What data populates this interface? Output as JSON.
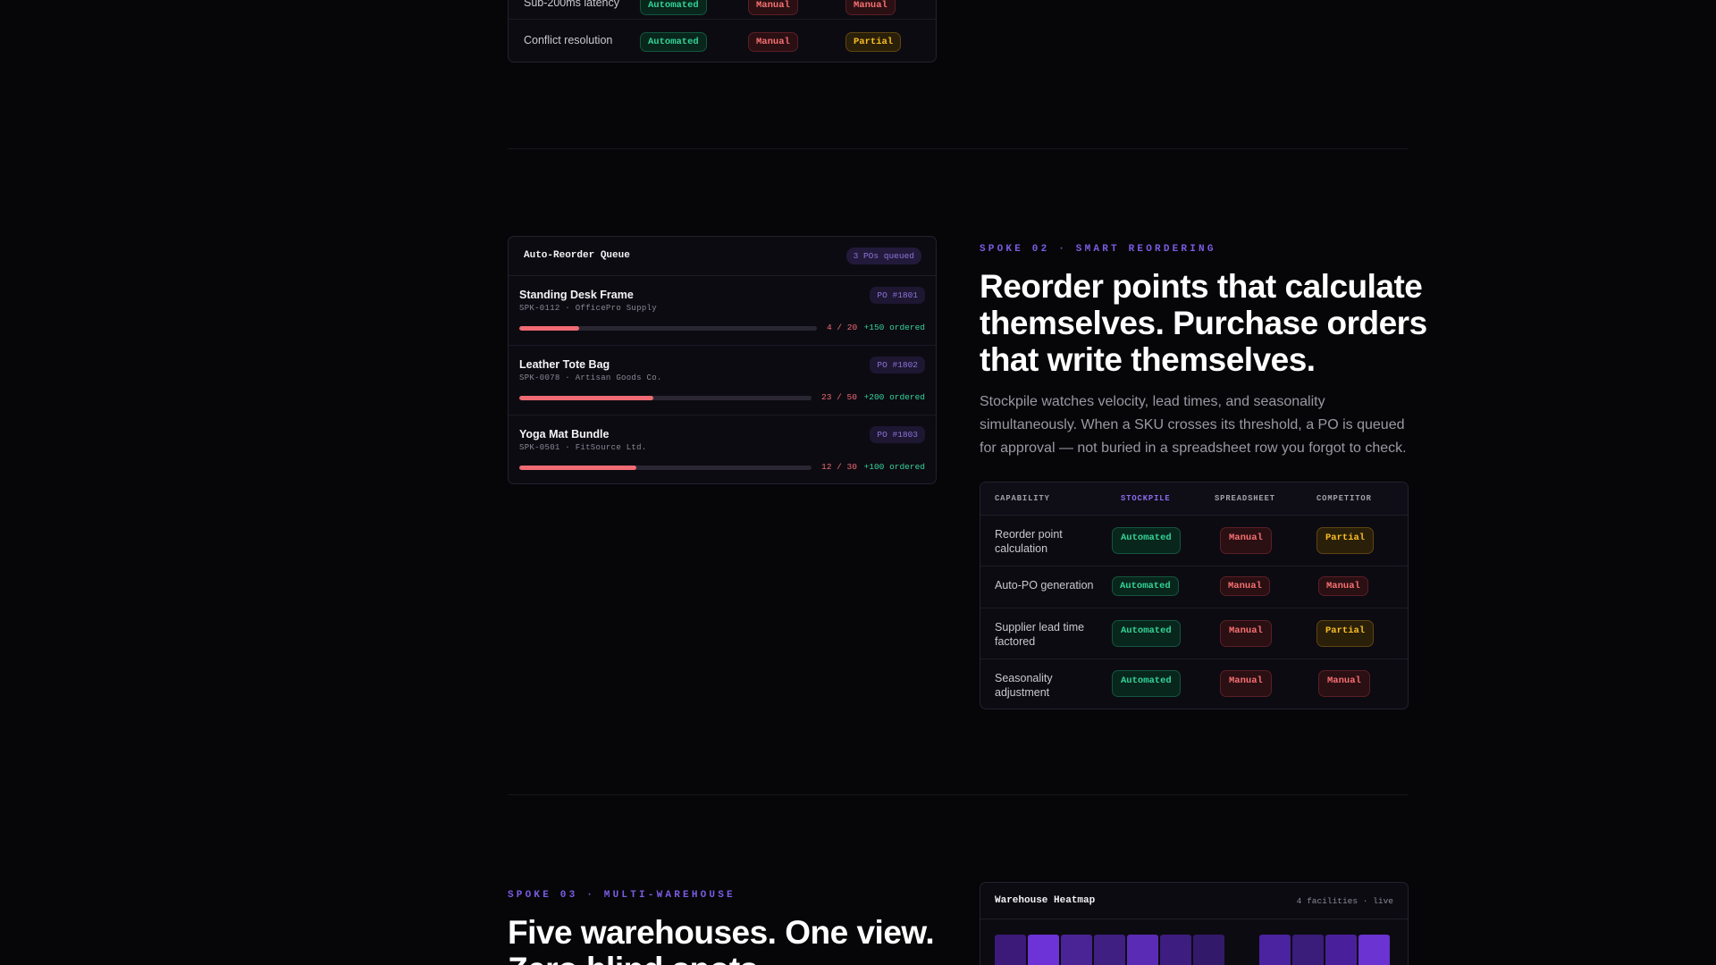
{
  "top_table": {
    "rows": [
      {
        "label": "Sub-200ms latency",
        "stockpile": "Automated",
        "spreadsheet": "Manual",
        "competitor": "Manual"
      },
      {
        "label": "Conflict resolution",
        "stockpile": "Automated",
        "spreadsheet": "Manual",
        "competitor": "Partial"
      }
    ]
  },
  "queue": {
    "title": "Auto-Reorder Queue",
    "count": "3 POs queued",
    "items": [
      {
        "name": "Standing Desk Frame",
        "sku": "SPK-0112 · OfficePro Supply",
        "po": "PO #1801",
        "stock": "4 / 20",
        "ordered": "+150 ordered",
        "level": 0.2
      },
      {
        "name": "Leather Tote Bag",
        "sku": "SPK-0078 · Artisan Goods Co.",
        "po": "PO #1802",
        "stock": "23 / 50",
        "ordered": "+200 ordered",
        "level": 0.46
      },
      {
        "name": "Yoga Mat Bundle",
        "sku": "SPK-0501 · FitSource Ltd.",
        "po": "PO #1803",
        "stock": "12 / 30",
        "ordered": "+100 ordered",
        "level": 0.4
      }
    ]
  },
  "spoke2": {
    "eyebrow": "SPOKE 02 · SMART REORDERING",
    "headline_1": "Reorder points that calculate",
    "headline_2": "themselves. Purchase orders",
    "headline_3": "that write themselves.",
    "body_1": "Stockpile watches velocity, lead times, and seasonality",
    "body_2": "simultaneously. When a SKU crosses its threshold, a PO is queued",
    "body_3": "for approval — not buried in a spreadsheet row you forgot to check."
  },
  "capability_table": {
    "headers": {
      "capability": "CAPABILITY",
      "stockpile": "STOCKPILE",
      "spreadsheet": "SPREADSHEET",
      "competitor": "COMPETITOR"
    },
    "rows": [
      {
        "label_1": "Reorder point",
        "label_2": "calculation",
        "stockpile": "Automated",
        "spreadsheet": "Manual",
        "competitor": "Partial"
      },
      {
        "label_1": "Auto-PO generation",
        "label_2": "",
        "stockpile": "Automated",
        "spreadsheet": "Manual",
        "competitor": "Manual"
      },
      {
        "label_1": "Supplier lead time",
        "label_2": "factored",
        "stockpile": "Automated",
        "spreadsheet": "Manual",
        "competitor": "Partial"
      },
      {
        "label_1": "Seasonality",
        "label_2": "adjustment",
        "stockpile": "Automated",
        "spreadsheet": "Manual",
        "competitor": "Manual"
      }
    ]
  },
  "spoke3": {
    "eyebrow": "SPOKE 03 · MULTI-WAREHOUSE",
    "headline_1": "Five warehouses. One view.",
    "headline_2": "Zero blind spots."
  },
  "heatmap": {
    "title": "Warehouse Heatmap",
    "meta": "4 facilities · live",
    "cells": [
      "#3b1a7a",
      "#6d33d6",
      "#4a2494",
      "#3f1f82",
      "#5a2cb6",
      "#3e1d80",
      "#33196a",
      "#0d0b12",
      "#4b22a0",
      "#3a1c7a",
      "#4a1f9c",
      "#6a33d2"
    ]
  },
  "colors": {
    "accent": "#7c5ce6",
    "automated": "#34d399",
    "manual": "#f87171",
    "partial": "#fbbf24",
    "stock_bar": "#f06b73"
  }
}
